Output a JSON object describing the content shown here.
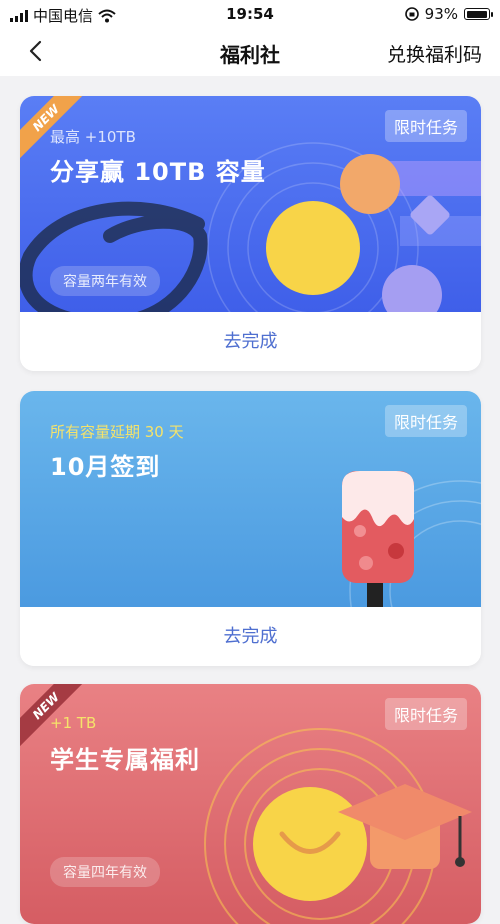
{
  "status_bar": {
    "carrier": "中国电信",
    "time": "19:54",
    "battery": "93%"
  },
  "nav": {
    "title": "福利社",
    "redeem_label": "兑换福利码"
  },
  "cards": [
    {
      "badge": "NEW",
      "subtitle": "最高 +10TB",
      "title": "分享赢 10TB 容量",
      "tag": "限时任务",
      "validity": "容量两年有效",
      "action": "去完成"
    },
    {
      "subtitle": "所有容量延期 30 天",
      "title": "10月签到",
      "tag": "限时任务",
      "action": "去完成"
    },
    {
      "badge": "NEW",
      "subtitle": "+1 TB",
      "title": "学生专属福利",
      "tag": "限时任务",
      "validity": "容量四年有效"
    }
  ],
  "colors": {
    "card1_gradient": [
      "#5b7df3",
      "#3c5ce8"
    ],
    "card2_gradient": [
      "#6cb4ea",
      "#4a97de"
    ],
    "card3_gradient": [
      "#e87c7f",
      "#d4585f"
    ],
    "action_text": "#4f6fd0"
  },
  "icons": [
    "wifi-icon",
    "back-arrow-icon",
    "share-planet-icon",
    "popsicle-icon",
    "graduation-cap-icon"
  ]
}
